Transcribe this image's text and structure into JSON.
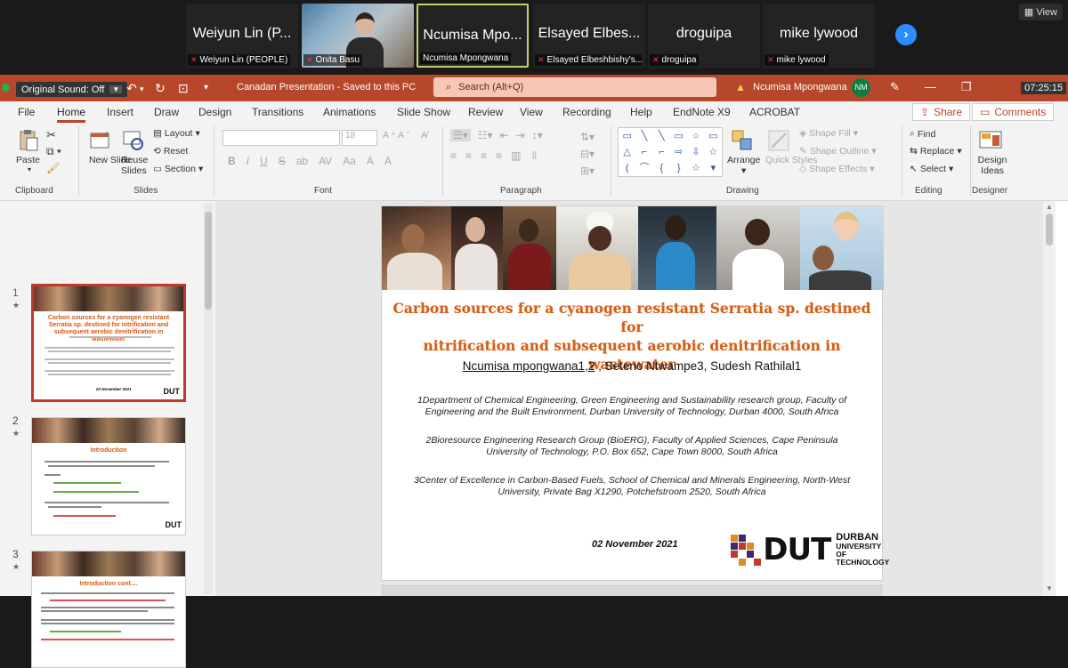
{
  "zoom": {
    "participants": [
      {
        "display": "Weiyun Lin (P...",
        "label": "Weiyun Lin (PEOPLE)"
      },
      {
        "display": "",
        "label": "Onita Basu"
      },
      {
        "display": "Ncumisa Mpo...",
        "label": "Ncumisa Mpongwana"
      },
      {
        "display": "Elsayed Elbes...",
        "label": "Elsayed Elbeshbishy's..."
      },
      {
        "display": "droguipa",
        "label": "droguipa"
      },
      {
        "display": "mike lywood",
        "label": "mike lywood"
      }
    ],
    "view_label": "View",
    "original_sound": "Original Sound: Off",
    "clock": "07:25:15"
  },
  "titlebar": {
    "doc_title": "Canadan Presentation  -  Saved to this PC",
    "search_placeholder": "Search (Alt+Q)",
    "user_name": "Ncumisa Mpongwana",
    "user_initials": "NM"
  },
  "menu": {
    "tabs": [
      "File",
      "Home",
      "Insert",
      "Draw",
      "Design",
      "Transitions",
      "Animations",
      "Slide Show",
      "Review",
      "View",
      "Recording",
      "Help",
      "EndNote X9",
      "ACROBAT"
    ],
    "active": "Home",
    "share": "Share",
    "comments": "Comments"
  },
  "ribbon": {
    "clipboard": {
      "paste": "Paste",
      "label": "Clipboard"
    },
    "slides": {
      "new_slide": "New Slide",
      "reuse": "Reuse Slides",
      "layout": "Layout",
      "reset": "Reset",
      "section": "Section",
      "label": "Slides"
    },
    "font": {
      "size": "18",
      "label": "Font"
    },
    "paragraph": {
      "label": "Paragraph"
    },
    "drawing": {
      "arrange": "Arrange",
      "quick_styles": "Quick Styles",
      "shape_fill": "Shape Fill",
      "shape_outline": "Shape Outline",
      "shape_effects": "Shape Effects",
      "label": "Drawing"
    },
    "editing": {
      "find": "Find",
      "replace": "Replace",
      "select": "Select",
      "label": "Editing"
    },
    "designer": {
      "ideas": "Design Ideas",
      "label": "Designer"
    }
  },
  "thumbnails": [
    {
      "num": "1",
      "title": "Carbon sources for a cyanogen resistant Serratia sp. destined for nitrification and subsequent aerobic denitrification in wastewater",
      "date": "02 November 2021"
    },
    {
      "num": "2",
      "title": "Introduction"
    },
    {
      "num": "3",
      "title": "Introduction cont...."
    }
  ],
  "slide": {
    "title_line1": "Carbon sources for a cyanogen resistant Serratia sp. destined for",
    "title_line2": "nitrification and subsequent aerobic denitrification in wastewater",
    "author1": "Ncumisa mpongwana1,2",
    "authors_rest": " , Seteno Ntwampe3, Sudesh Rathilal1",
    "affil1": "1Department of Chemical Engineering, Green Engineering and Sustainability research group, Faculty of Engineering and the Built Environment, Durban University of Technology, Durban 4000, South Africa",
    "affil2": "2Bioresource Engineering Research Group (BioERG), Faculty of Applied Sciences, Cape Peninsula University of Technology, P.O. Box 652, Cape Town 8000, South Africa",
    "affil3": "3Center of Excellence in Carbon-Based Fuels, School of Chemical and Minerals Engineering, North-West University, Private Bag X1290, Potchefstroom 2520, South Africa",
    "date": "02 November 2021",
    "logo_word": "DUT",
    "logo_sub1": "DURBAN",
    "logo_sub2": "UNIVERSITY OF",
    "logo_sub3": "TECHNOLOGY"
  },
  "colors": {
    "ppt_accent": "#b7472a",
    "title_orange": "#d35f1b",
    "zoom_blue": "#2d8cff"
  }
}
